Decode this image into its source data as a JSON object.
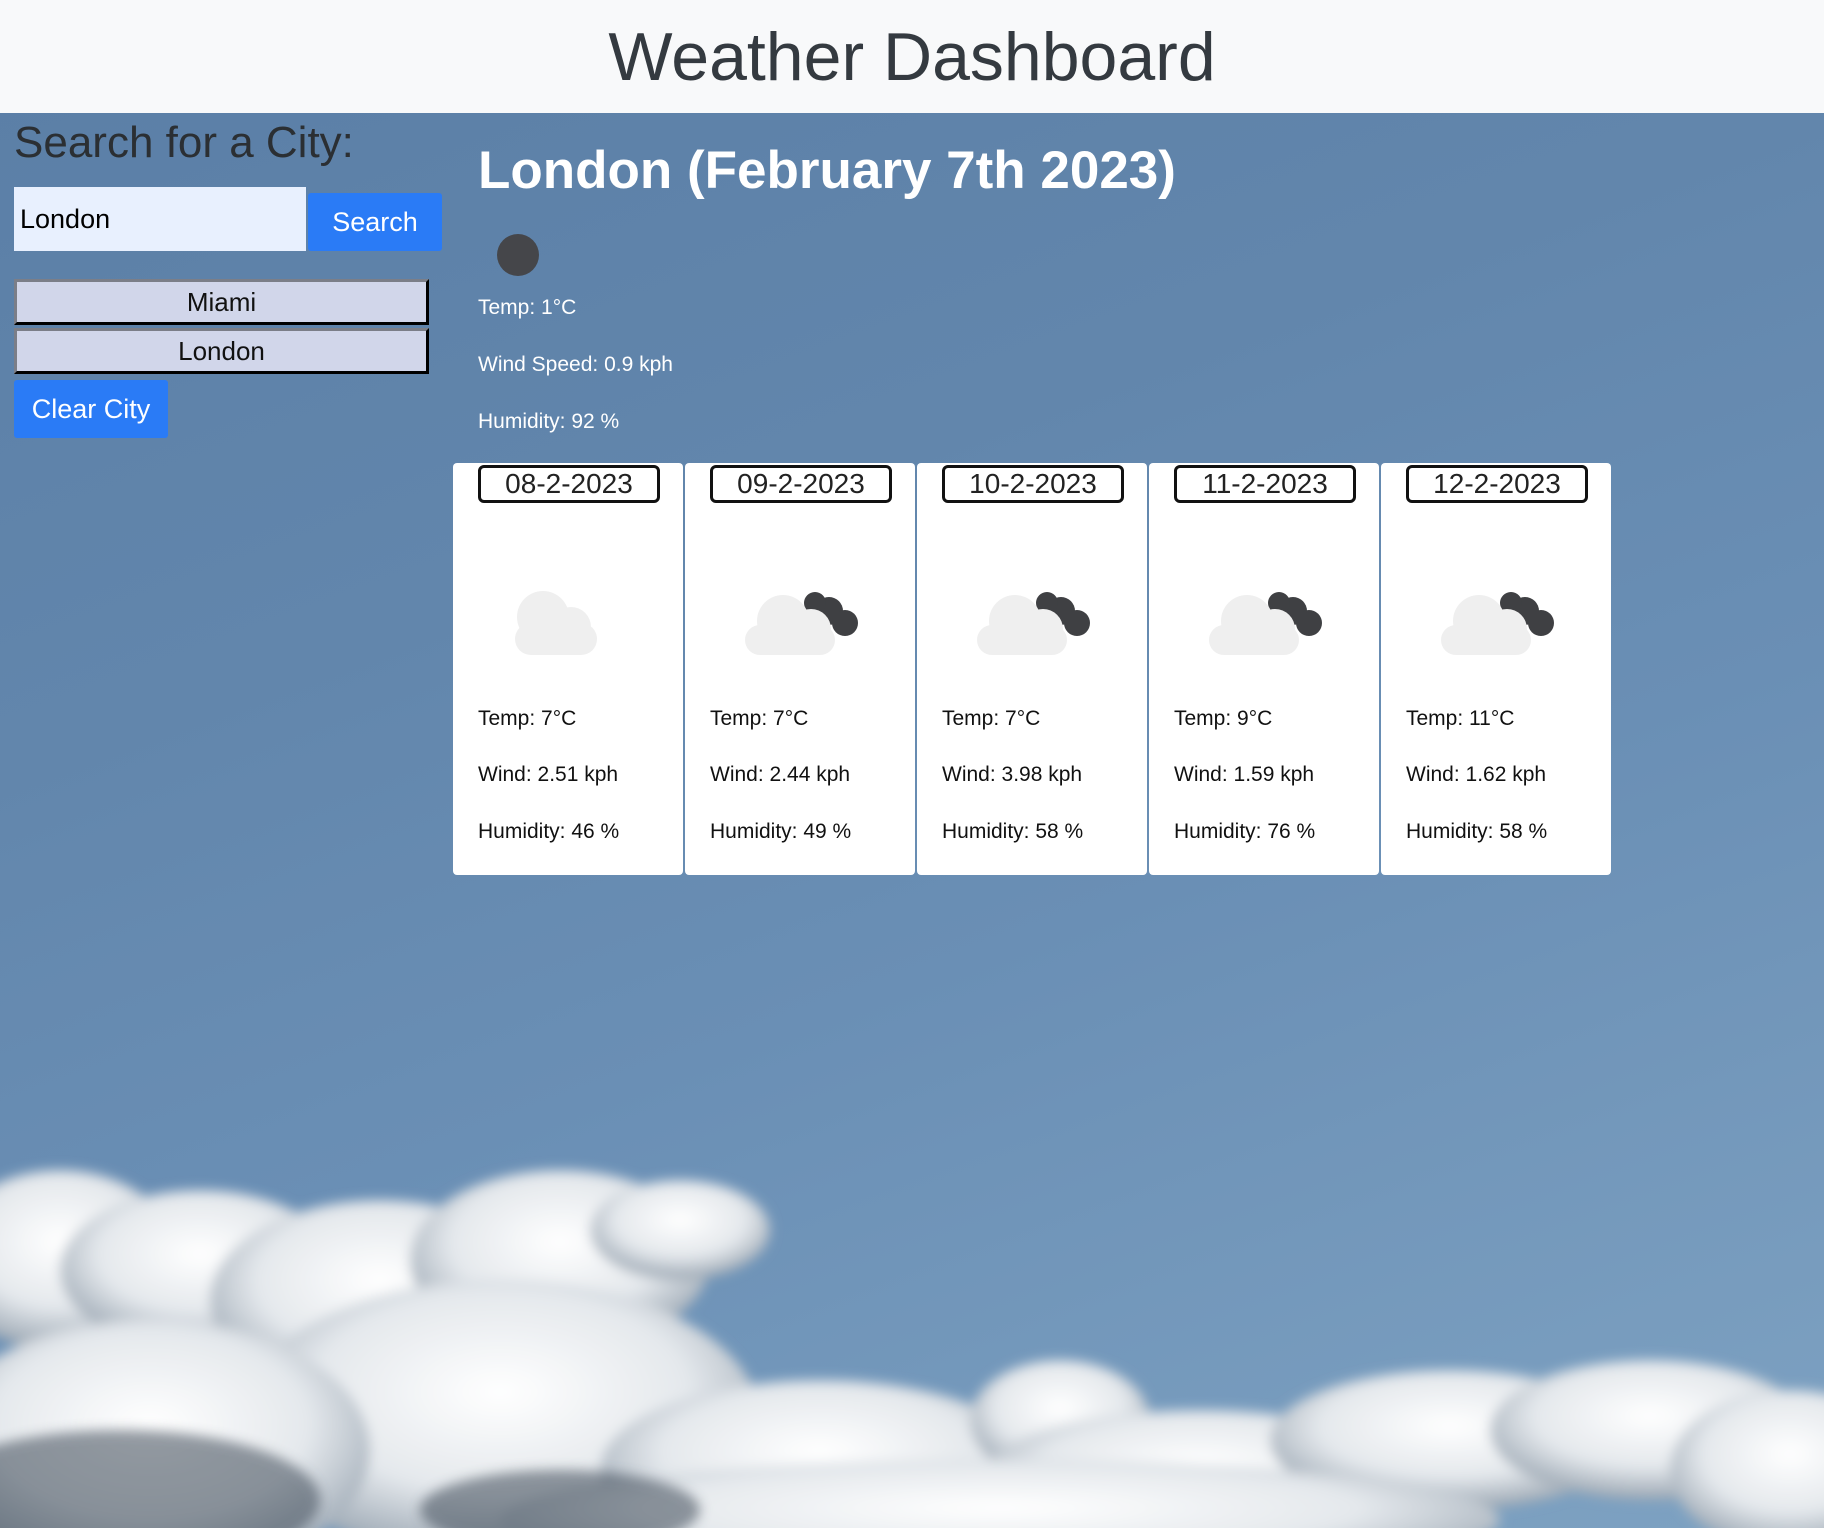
{
  "header": {
    "title": "Weather Dashboard"
  },
  "sidebar": {
    "heading": "Search for a City:",
    "search_value": "London",
    "search_button": "Search",
    "history": [
      "Miami",
      "London"
    ],
    "clear_button": "Clear City"
  },
  "current": {
    "title": "London (February 7th 2023)",
    "icon": "night-clear-icon",
    "temp": "Temp: 1°C",
    "wind": "Wind Speed: 0.9 kph",
    "humidity": "Humidity: 92 %"
  },
  "forecast": [
    {
      "date": "08-2-2023",
      "icon": "cloud-icon",
      "temp": "Temp: 7°C",
      "wind": "Wind: 2.51 kph",
      "humidity": "Humidity: 46 %"
    },
    {
      "date": "09-2-2023",
      "icon": "broken-clouds-icon",
      "temp": "Temp: 7°C",
      "wind": "Wind: 2.44 kph",
      "humidity": "Humidity: 49 %"
    },
    {
      "date": "10-2-2023",
      "icon": "broken-clouds-icon",
      "temp": "Temp: 7°C",
      "wind": "Wind: 3.98 kph",
      "humidity": "Humidity: 58 %"
    },
    {
      "date": "11-2-2023",
      "icon": "broken-clouds-icon",
      "temp": "Temp: 9°C",
      "wind": "Wind: 1.59 kph",
      "humidity": "Humidity: 76 %"
    },
    {
      "date": "12-2-2023",
      "icon": "broken-clouds-icon",
      "temp": "Temp: 11°C",
      "wind": "Wind: 1.62 kph",
      "humidity": "Humidity: 58 %"
    }
  ],
  "colors": {
    "accent": "#2a7bf6",
    "header_bg": "#f8f9fa",
    "history_bg": "#d1d6ea"
  }
}
